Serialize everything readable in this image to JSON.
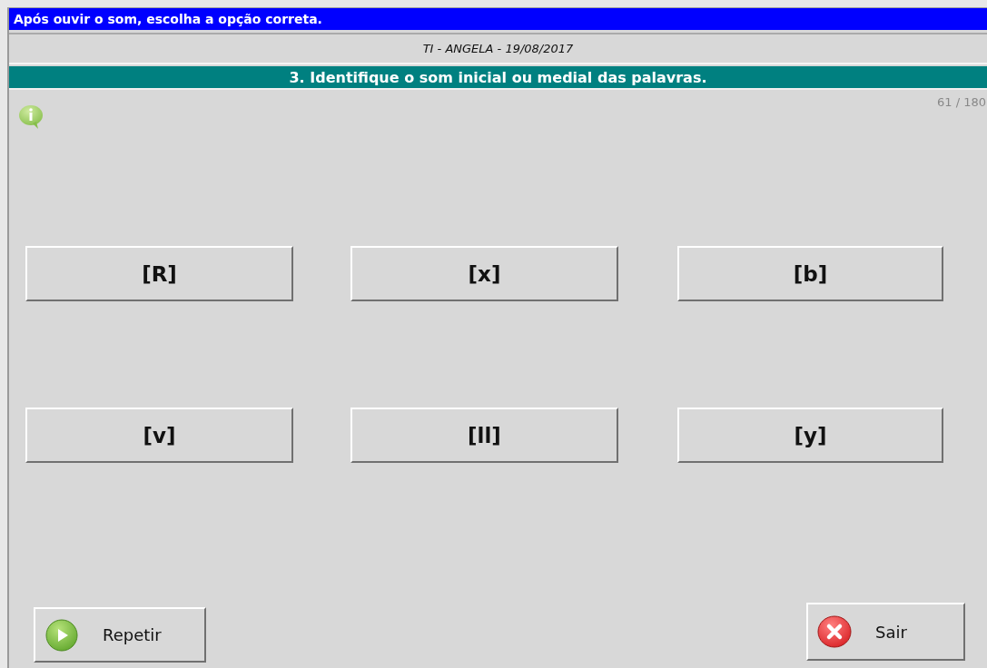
{
  "instruction": "Após ouvir o som, escolha a opção correta.",
  "session": "TI - ANGELA - 19/08/2017",
  "exercise_title": "3. Identifique o som inicial ou medial das palavras.",
  "progress": "61 / 180",
  "options": [
    {
      "label": "[R]"
    },
    {
      "label": "[x]"
    },
    {
      "label": "[b]"
    },
    {
      "label": "[v]"
    },
    {
      "label": "[ll]"
    },
    {
      "label": "[y]"
    }
  ],
  "buttons": [
    {
      "kind": "repeat",
      "label": "Repetir"
    },
    {
      "kind": "exit",
      "label": "Sair"
    }
  ]
}
